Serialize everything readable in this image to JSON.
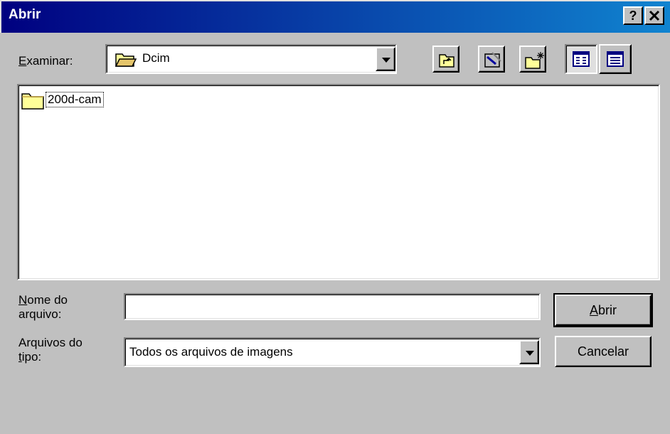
{
  "window": {
    "title": "Abrir",
    "help_label": "?",
    "close_label": "×"
  },
  "lookin": {
    "label_ul": "E",
    "label_rest": "xaminar:",
    "value": "Dcim"
  },
  "toolbar": {
    "icons": [
      "up-one-level-icon",
      "desktop-icon",
      "create-new-folder-icon",
      "list-view-icon",
      "details-view-icon"
    ]
  },
  "file_list": {
    "items": [
      {
        "name": "200d-cam",
        "icon": "folder-icon"
      }
    ]
  },
  "filename": {
    "label_ul": "N",
    "label_line1_rest": "ome do",
    "label_line2": "arquivo:",
    "value": "",
    "placeholder": ""
  },
  "filetype": {
    "label_line1": "Arquivos do",
    "label_ul": "t",
    "label_line2_rest": "ipo:",
    "value": "Todos os arquivos de imagens"
  },
  "buttons": {
    "open_ul": "A",
    "open_rest": "brir",
    "cancel": "Cancelar"
  }
}
